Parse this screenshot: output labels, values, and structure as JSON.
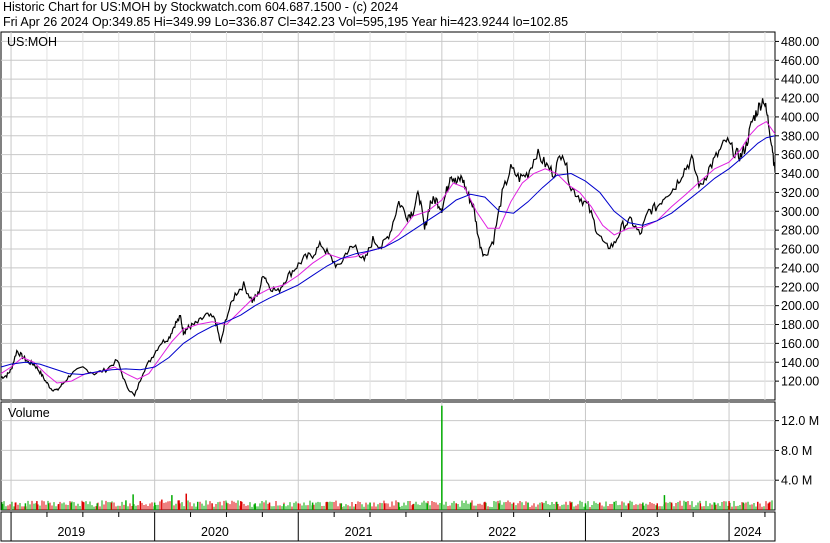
{
  "header": {
    "line1": "Historic Chart for US:MOH by Stockwatch.com 604.687.1500 - (c) 2024",
    "line2": "Fri Apr 26 2024   Op:349.85   Hi=349.99   Lo=336.87   Cl=342.23   Vol=595,195   Year hi=423.9244   lo=102.85"
  },
  "price_panel": {
    "symbol": "US:MOH"
  },
  "volume_panel": {
    "label": "Volume"
  },
  "colors": {
    "price": "#000000",
    "ma_short": "#e020e0",
    "ma_long": "#0000cc",
    "volume_up": "#00aa00",
    "volume_down": "#dd0000",
    "grid": "#c8c8c8",
    "panel_border": "#000000"
  },
  "chart_data": [
    {
      "type": "line",
      "title": "US:MOH",
      "x_labels": [
        "2019",
        "2020",
        "2021",
        "2022",
        "2023",
        "2024"
      ],
      "ylim": [
        100,
        490
      ],
      "y_ticks": [
        "480.00",
        "460.00",
        "440.00",
        "420.00",
        "400.00",
        "380.00",
        "360.00",
        "340.00",
        "320.00",
        "300.00",
        "280.00",
        "260.00",
        "240.00",
        "220.00",
        "200.00",
        "180.00",
        "160.00",
        "140.00",
        "120.00"
      ],
      "x_domain": [
        2018.93,
        2024.32
      ],
      "series": [
        {
          "key": "price",
          "x": [
            2018.93,
            2018.97,
            2019.0,
            2019.04,
            2019.08,
            2019.12,
            2019.16,
            2019.2,
            2019.24,
            2019.28,
            2019.32,
            2019.36,
            2019.42,
            2019.5,
            2019.58,
            2019.66,
            2019.74,
            2019.8,
            2019.86,
            2019.92,
            2019.98,
            2020.04,
            2020.1,
            2020.14,
            2020.18,
            2020.2,
            2020.22,
            2020.25,
            2020.3,
            2020.36,
            2020.42,
            2020.46,
            2020.5,
            2020.56,
            2020.62,
            2020.68,
            2020.72,
            2020.76,
            2020.8,
            2020.86,
            2020.92,
            2020.98,
            2021.04,
            2021.1,
            2021.16,
            2021.22,
            2021.28,
            2021.34,
            2021.4,
            2021.46,
            2021.52,
            2021.58,
            2021.64,
            2021.7,
            2021.76,
            2021.8,
            2021.84,
            2021.88,
            2021.92,
            2021.96,
            2022.0,
            2022.04,
            2022.06,
            2022.1,
            2022.14,
            2022.18,
            2022.22,
            2022.26,
            2022.3,
            2022.36,
            2022.42,
            2022.48,
            2022.54,
            2022.6,
            2022.66,
            2022.72,
            2022.78,
            2022.84,
            2022.9,
            2022.96,
            2023.02,
            2023.08,
            2023.14,
            2023.2,
            2023.26,
            2023.32,
            2023.38,
            2023.44,
            2023.5,
            2023.56,
            2023.62,
            2023.68,
            2023.74,
            2023.8,
            2023.86,
            2023.92,
            2023.98,
            2024.04,
            2024.08,
            2024.12,
            2024.16,
            2024.2,
            2024.24,
            2024.27,
            2024.3,
            2024.32
          ],
          "values": [
            124,
            126,
            132,
            152,
            146,
            140,
            138,
            130,
            120,
            112,
            110,
            117,
            128,
            134,
            128,
            132,
            142,
            116,
            104,
            130,
            145,
            160,
            166,
            180,
            188,
            172,
            175,
            178,
            182,
            190,
            186,
            160,
            188,
            212,
            222,
            205,
            212,
            234,
            220,
            215,
            230,
            240,
            250,
            254,
            265,
            252,
            240,
            258,
            263,
            246,
            270,
            262,
            278,
            310,
            295,
            300,
            320,
            280,
            310,
            312,
            303,
            325,
            340,
            330,
            336,
            318,
            305,
            268,
            252,
            270,
            318,
            345,
            335,
            340,
            362,
            350,
            340,
            365,
            325,
            315,
            305,
            280,
            262,
            265,
            285,
            290,
            275,
            300,
            305,
            318,
            325,
            342,
            355,
            325,
            345,
            360,
            375,
            362,
            358,
            370,
            395,
            408,
            420,
            398,
            370,
            342
          ]
        },
        {
          "key": "ma_short",
          "x": [
            2018.93,
            2019.0,
            2019.08,
            2019.16,
            2019.24,
            2019.32,
            2019.42,
            2019.52,
            2019.62,
            2019.72,
            2019.8,
            2019.88,
            2019.96,
            2020.04,
            2020.12,
            2020.2,
            2020.3,
            2020.4,
            2020.5,
            2020.6,
            2020.7,
            2020.8,
            2020.9,
            2021.0,
            2021.1,
            2021.2,
            2021.3,
            2021.4,
            2021.5,
            2021.6,
            2021.7,
            2021.8,
            2021.9,
            2022.0,
            2022.08,
            2022.16,
            2022.24,
            2022.32,
            2022.4,
            2022.48,
            2022.56,
            2022.64,
            2022.72,
            2022.8,
            2022.88,
            2022.96,
            2023.04,
            2023.12,
            2023.2,
            2023.3,
            2023.4,
            2023.5,
            2023.6,
            2023.7,
            2023.8,
            2023.9,
            2024.0,
            2024.08,
            2024.14,
            2024.2,
            2024.26,
            2024.32
          ],
          "values": [
            128,
            135,
            145,
            140,
            128,
            118,
            120,
            128,
            130,
            135,
            128,
            122,
            128,
            145,
            162,
            175,
            180,
            183,
            180,
            195,
            210,
            218,
            222,
            232,
            245,
            255,
            250,
            252,
            258,
            262,
            275,
            295,
            300,
            312,
            330,
            325,
            300,
            282,
            282,
            310,
            330,
            340,
            345,
            340,
            328,
            320,
            305,
            285,
            275,
            282,
            283,
            290,
            305,
            318,
            332,
            345,
            352,
            365,
            380,
            390,
            395,
            382
          ]
        },
        {
          "key": "ma_long",
          "x": [
            2018.93,
            2019.0,
            2019.1,
            2019.2,
            2019.3,
            2019.4,
            2019.5,
            2019.6,
            2019.7,
            2019.8,
            2019.9,
            2020.0,
            2020.1,
            2020.2,
            2020.3,
            2020.4,
            2020.5,
            2020.6,
            2020.7,
            2020.8,
            2020.9,
            2021.0,
            2021.1,
            2021.2,
            2021.3,
            2021.4,
            2021.5,
            2021.6,
            2021.7,
            2021.8,
            2021.9,
            2022.0,
            2022.1,
            2022.2,
            2022.3,
            2022.4,
            2022.5,
            2022.6,
            2022.7,
            2022.8,
            2022.9,
            2023.0,
            2023.1,
            2023.2,
            2023.3,
            2023.4,
            2023.5,
            2023.6,
            2023.7,
            2023.8,
            2023.9,
            2024.0,
            2024.1,
            2024.2,
            2024.26,
            2024.32
          ],
          "values": [
            135,
            138,
            140,
            138,
            133,
            128,
            127,
            130,
            132,
            133,
            132,
            135,
            145,
            160,
            170,
            178,
            183,
            190,
            200,
            208,
            215,
            222,
            232,
            242,
            250,
            255,
            258,
            262,
            270,
            280,
            290,
            300,
            312,
            318,
            315,
            300,
            298,
            310,
            325,
            338,
            340,
            332,
            320,
            300,
            288,
            285,
            290,
            298,
            310,
            322,
            335,
            345,
            358,
            372,
            378,
            380
          ]
        }
      ]
    },
    {
      "type": "bar",
      "title": "Volume",
      "ylim": [
        0,
        14.5
      ],
      "y_ticks": [
        "12.0 M",
        "8.0 M",
        "4.0 M"
      ],
      "series": [
        {
          "name": "Volume",
          "x": [
            2018.94,
            2019.03,
            2019.1,
            2019.18,
            2019.26,
            2019.33,
            2019.42,
            2019.5,
            2019.6,
            2019.7,
            2019.8,
            2019.85,
            2019.9,
            2020.0,
            2020.05,
            2020.12,
            2020.17,
            2020.22,
            2020.3,
            2020.4,
            2020.5,
            2020.6,
            2020.7,
            2020.8,
            2020.9,
            2021.0,
            2021.1,
            2021.2,
            2021.3,
            2021.4,
            2021.5,
            2021.6,
            2021.7,
            2021.8,
            2021.9,
            2022.0,
            2022.1,
            2022.2,
            2022.3,
            2022.4,
            2022.5,
            2022.6,
            2022.7,
            2022.8,
            2022.9,
            2023.0,
            2023.1,
            2023.2,
            2023.3,
            2023.4,
            2023.5,
            2023.55,
            2023.6,
            2023.7,
            2023.8,
            2023.9,
            2024.0,
            2024.1,
            2024.2,
            2024.28
          ],
          "values": [
            0.8,
            1.0,
            0.9,
            1.2,
            0.9,
            0.8,
            1.0,
            1.1,
            0.9,
            1.0,
            1.3,
            2.1,
            1.2,
            1.0,
            1.4,
            2.0,
            1.3,
            2.2,
            1.1,
            0.9,
            1.0,
            1.2,
            0.9,
            1.0,
            0.8,
            0.9,
            1.0,
            1.1,
            0.9,
            0.8,
            1.0,
            0.9,
            1.0,
            0.8,
            0.9,
            14.0,
            0.9,
            1.0,
            1.1,
            0.9,
            1.0,
            1.0,
            0.9,
            1.1,
            1.0,
            0.9,
            1.0,
            1.1,
            0.9,
            1.0,
            0.9,
            2.0,
            1.0,
            1.1,
            0.9,
            1.0,
            1.2,
            1.0,
            1.1,
            1.0
          ],
          "up": [
            true,
            false,
            true,
            false,
            true,
            false,
            true,
            false,
            true,
            false,
            true,
            true,
            false,
            true,
            false,
            true,
            false,
            false,
            true,
            false,
            true,
            false,
            true,
            false,
            true,
            false,
            true,
            false,
            true,
            false,
            true,
            false,
            true,
            false,
            true,
            true,
            false,
            true,
            false,
            true,
            false,
            true,
            false,
            true,
            false,
            true,
            false,
            true,
            false,
            true,
            false,
            true,
            false,
            true,
            false,
            true,
            false,
            true,
            false,
            false
          ]
        }
      ]
    }
  ],
  "x_axis": {
    "labels": [
      "2019",
      "2020",
      "2021",
      "2022",
      "2023",
      "2024"
    ],
    "label_years": [
      2019.42,
      2020.42,
      2021.42,
      2022.42,
      2023.42,
      2024.13
    ],
    "divider_years": [
      2019.0,
      2020.0,
      2021.0,
      2022.0,
      2023.0,
      2024.0
    ]
  }
}
